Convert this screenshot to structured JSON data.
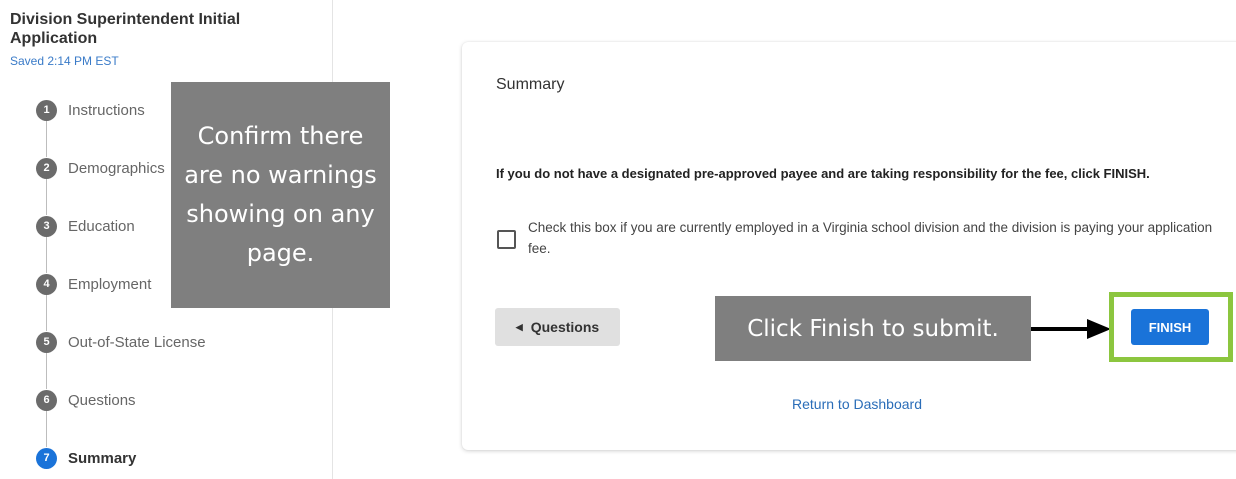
{
  "sidebar": {
    "title": "Division Superintendent Initial Application",
    "saved": "Saved 2:14 PM EST",
    "steps": [
      {
        "num": "1",
        "label": "Instructions"
      },
      {
        "num": "2",
        "label": "Demographics"
      },
      {
        "num": "3",
        "label": "Education"
      },
      {
        "num": "4",
        "label": "Employment"
      },
      {
        "num": "5",
        "label": "Out-of-State License"
      },
      {
        "num": "6",
        "label": "Questions"
      },
      {
        "num": "7",
        "label": "Summary"
      }
    ],
    "active_step": 7
  },
  "callouts": {
    "left": "Confirm there are no warnings showing on any page.",
    "right": "Click Finish to submit."
  },
  "card": {
    "title": "Summary",
    "notice": "If you do not have a designated pre-approved payee and are taking responsibility for the fee, click FINISH.",
    "checkbox_label": "Check this box if you are currently employed in a Virginia school division and the division is paying your application fee.",
    "checkbox_checked": false,
    "back_button": "Questions",
    "finish_button": "FINISH",
    "return_link": "Return to Dashboard"
  },
  "colors": {
    "accent": "#1a73d9",
    "highlight_frame": "#8cc63f",
    "callout_bg": "#7f7f7f"
  }
}
